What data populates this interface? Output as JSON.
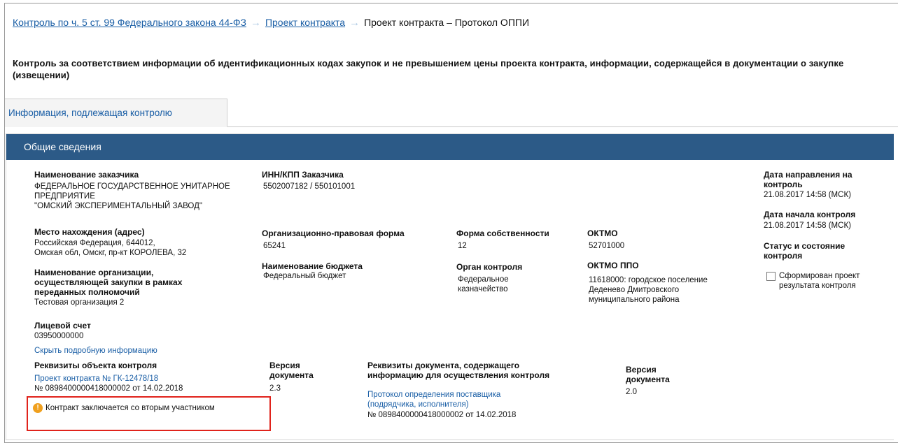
{
  "breadcrumb": {
    "item1": "Контроль по ч. 5 ст. 99 Федерального закона 44-ФЗ",
    "item2": "Проект контракта",
    "current": "Проект контракта – Протокол ОППИ",
    "arrow": "→"
  },
  "page_title": "Контроль за соответствием информации об идентификационных кодах закупок и не превышением цены проекта контракта, информации, содержащейся в документации о закупке (извещении)",
  "tabs": [
    {
      "label": "Информация, подлежащая контролю"
    }
  ],
  "section": {
    "title": "Общие сведения"
  },
  "customer": {
    "name_label": "Наименование заказчика",
    "name_lines": [
      "ФЕДЕРАЛЬНОЕ ГОСУДАРСТВЕННОЕ УНИТАРНОЕ",
      "ПРЕДПРИЯТИЕ",
      "\"ОМСКИЙ ЭКСПЕРИМЕНТАЛЬНЫЙ ЗАВОД\""
    ],
    "inn_label": "ИНН/КПП Заказчика",
    "inn_value": "5502007182 / 550101001",
    "address_label": "Место нахождения (адрес)",
    "address_lines": [
      "Российская Федерация, 644012,",
      "Омская обл, Омскг, пр-кт КОРОЛЕВА, 32"
    ],
    "opf_label": "Организационно-правовая форма",
    "opf_value": "65241",
    "ownership_label": "Форма собственности",
    "ownership_value": "12",
    "oktmo_label": "ОКТМО",
    "oktmo_value": "52701000",
    "org_label_lines": [
      "Наименование организации,",
      "осуществляющей закупки в рамках",
      "переданных полномочий"
    ],
    "org_value": "Тестовая организация 2",
    "budget_label": "Наименование бюджета",
    "budget_value": "Федеральный бюджет",
    "control_body_label": "Орган контроля",
    "control_body_lines": [
      "Федеральное",
      "казначейство"
    ],
    "oktmo_ppo_label": "ОКТМО ППО",
    "oktmo_ppo_lines": [
      "11618000: городское поселение",
      "Деденево Дмитровского",
      "муниципального района"
    ],
    "account_label": "Лицевой счет",
    "account_value": "03950000000",
    "hide_link": "Скрыть подробную информацию"
  },
  "right_panel": {
    "sent_label_lines": [
      "Дата направления на",
      "контроль"
    ],
    "sent_value": "21.08.2017 14:58 (МСК)",
    "start_label": "Дата начала контроля",
    "start_value": "21.08.2017 14:58 (МСК)",
    "status_label_lines": [
      "Статус и состояние",
      "контроля"
    ],
    "checkbox_label": "Сформирован проект результата контроля"
  },
  "requisites": {
    "object_label": "Реквизиты объекта контроля",
    "object_link": "Проект контракта № ГК-12478/18",
    "object_number": "№ 0898400000418000002 от 14.02.2018",
    "version_label_lines": [
      "Версия",
      "документа"
    ],
    "version_value": "2.3",
    "doc_label_lines": [
      "Реквизиты документа, содержащего",
      "информацию для осуществления контроля"
    ],
    "doc_link_lines": [
      "Протокол определения поставщика",
      "(подрядчика, исполнителя)"
    ],
    "doc_number": "№ 0898400000418000002 от 14.02.2018",
    "doc_version_label_lines": [
      "Версия",
      "документа"
    ],
    "doc_version_value": "2.0"
  },
  "warning": {
    "icon": "warning-icon",
    "text": "Контракт заключается со вторым участником"
  },
  "colors": {
    "link": "#1b5fa6",
    "header_bg": "#2c5a87",
    "highlight_border": "#e0231c",
    "warning_icon": "#f0a01e"
  }
}
